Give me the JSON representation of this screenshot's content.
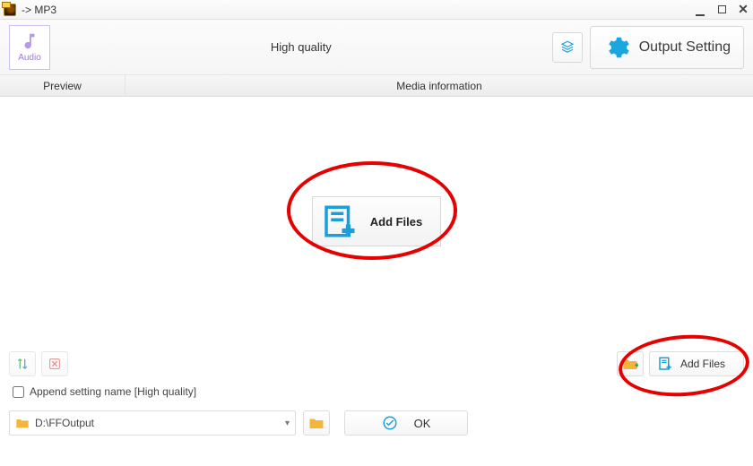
{
  "window": {
    "title": " -> MP3"
  },
  "toolbar": {
    "audio_label": "Audio",
    "quality_label": "High quality",
    "output_setting_label": "Output Setting"
  },
  "columns": {
    "preview": "Preview",
    "media_info": "Media information"
  },
  "main": {
    "add_files_label": "Add Files"
  },
  "actions": {
    "add_files_label": "Add Files"
  },
  "append": {
    "label": "Append setting name [High quality]",
    "checked": false
  },
  "output": {
    "path": "D:\\FFOutput"
  },
  "footer": {
    "ok_label": "OK"
  },
  "colors": {
    "accent": "#1a9edc",
    "annotation": "#e60000",
    "gear": "#1aa7e0"
  }
}
